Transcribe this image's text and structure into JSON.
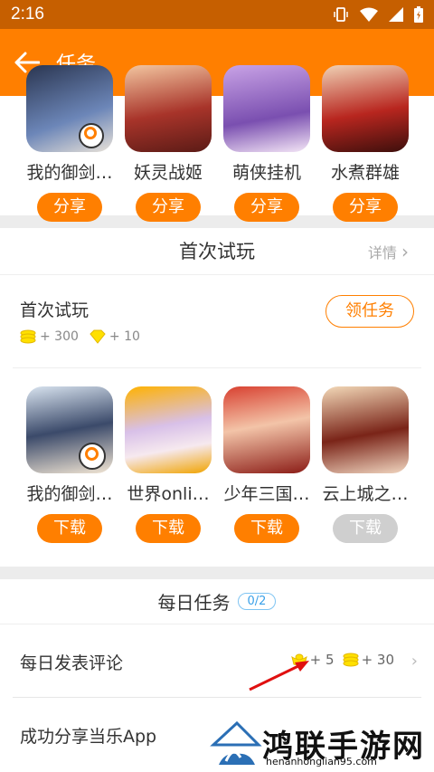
{
  "status_bar": {
    "time": "2:16"
  },
  "app_bar": {
    "title": "任务"
  },
  "share_section": {
    "games": [
      {
        "name": "我的御剑…",
        "button": "分享",
        "icon": "game-icon-1"
      },
      {
        "name": "妖灵战姬",
        "button": "分享",
        "icon": "game-icon-2"
      },
      {
        "name": "萌侠挂机",
        "button": "分享",
        "icon": "game-icon-3"
      },
      {
        "name": "水煮群雄",
        "button": "分享",
        "icon": "game-icon-4"
      }
    ]
  },
  "first_try": {
    "header": "首次试玩",
    "details": "详情",
    "task_title": "首次试玩",
    "coin_reward": "+ 300",
    "diamond_reward": "+ 10",
    "accept_label": "领任务",
    "games": [
      {
        "name": "我的御剑…",
        "button": "下载",
        "enabled": true
      },
      {
        "name": "世界onli…",
        "button": "下载",
        "enabled": true
      },
      {
        "name": "少年三国…",
        "button": "下载",
        "enabled": true
      },
      {
        "name": "云上城之…",
        "button": "下载",
        "enabled": false
      }
    ]
  },
  "daily": {
    "header": "每日任务",
    "progress": "0/2",
    "tasks": [
      {
        "label": "每日发表评论",
        "ingot_reward": "+ 5",
        "coin_reward": "+ 30"
      },
      {
        "label": "成功分享当乐App"
      }
    ]
  },
  "watermark": {
    "title": "鸿联手游网",
    "url": "henanhonglian95.com"
  },
  "colors": {
    "accent": "#ff7f00",
    "status_bar": "#c65f00"
  }
}
